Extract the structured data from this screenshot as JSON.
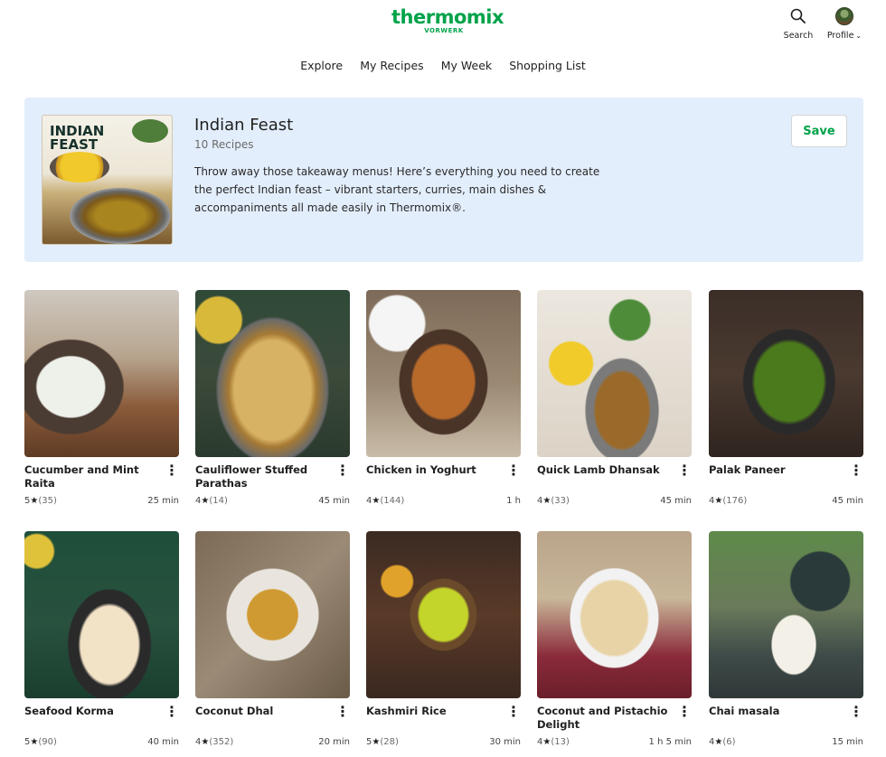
{
  "header": {
    "logo_text": "thermomix",
    "logo_sub": "VORWERK",
    "search_label": "Search",
    "profile_label": "Profile"
  },
  "nav": {
    "items": [
      "Explore",
      "My Recipes",
      "My Week",
      "Shopping List"
    ]
  },
  "collection": {
    "cover_title": "INDIAN FEAST",
    "title": "Indian Feast",
    "count": "10 Recipes",
    "description": "Throw away those takeaway menus! Here’s everything you need to create the perfect Indian feast – vibrant starters, curries, main dishes & accompaniments all made easily in Thermomix®.",
    "save_label": "Save"
  },
  "colors": {
    "brand_green": "#00a34a",
    "banner_bg": "#e3eefc"
  },
  "recipes": [
    {
      "title": "Cucumber and Mint Raita",
      "rating": "5",
      "reviews": "(35)",
      "time": "25 min"
    },
    {
      "title": "Cauliflower Stuffed Parathas",
      "rating": "4",
      "reviews": "(14)",
      "time": "45 min"
    },
    {
      "title": "Chicken in Yoghurt",
      "rating": "4",
      "reviews": "(144)",
      "time": "1 h"
    },
    {
      "title": "Quick Lamb Dhansak",
      "rating": "4",
      "reviews": "(33)",
      "time": "45 min"
    },
    {
      "title": "Palak Paneer",
      "rating": "4",
      "reviews": "(176)",
      "time": "45 min"
    },
    {
      "title": "Seafood Korma",
      "rating": "5",
      "reviews": "(90)",
      "time": "40 min"
    },
    {
      "title": "Coconut Dhal",
      "rating": "4",
      "reviews": "(352)",
      "time": "20 min"
    },
    {
      "title": "Kashmiri Rice",
      "rating": "5",
      "reviews": "(28)",
      "time": "30 min"
    },
    {
      "title": "Coconut and Pistachio Delight",
      "rating": "4",
      "reviews": "(13)",
      "time": "1 h 5 min"
    },
    {
      "title": "Chai masala",
      "rating": "4",
      "reviews": "(6)",
      "time": "15 min"
    }
  ]
}
